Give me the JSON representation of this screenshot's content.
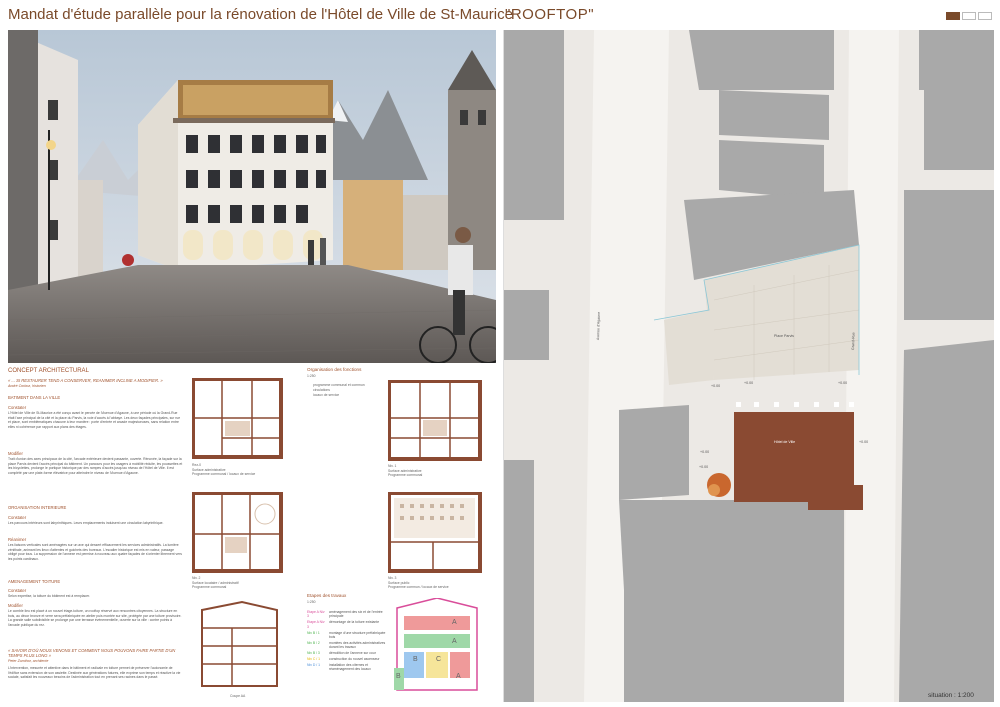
{
  "header": {
    "title": "Mandat d'étude parallèle pour la rénovation de l'Hôtel de Ville de St-Maurice",
    "project_name": "\"ROOFTOP\""
  },
  "concept": {
    "heading": "CONCEPT ARCHITECTURAL",
    "quote1": "« ... SI RESTAURER TEND A CONSERVER, REANIMER INCLINE A MODIFIER. »",
    "quote1_author": "André Corboz, historien",
    "s1_title": "BATIMENT DANS LA VILLE",
    "s1_constat": "Constater",
    "s1_p1": "L'Hôtel de Ville de St-Maurice a été conçu avant le percée de l'Avenue d'Agaune, à une période où la Grand-Rue était l'axe principal de la cité et la place du Parvis, la voie d'accès à l'abbaye. Les deux façades principales, sur rue et place, sont emblématiques chacune à leur manière : porte d'entrée et arcade majestueuses, sans relation entre elles ni cohérence par rapport aux plans des étages.",
    "s1_modif": "Modifier",
    "s1_p2": "Trait d'union des axes principaux de la cité, l'arcade extérieure devient passante, ouverte. Rénovée, la façade sur la place Parvis devient l'accès principal du bâtiment. Un parcours pour les usagers à mobilité réduite, les poussettes et les bicyclettes, prolonge le portique historique par des rampes d'accès jusqu'au niveau de l'Hôtel de Ville. Il est complété par une plate-forme élévatrice pour atteindre le niveau de l'Avenue d'Agaune.",
    "s2_title": "ORGANISATION INTERIEURE",
    "s2_constat": "Constater",
    "s2_p1": "Les parcours intérieurs sont labyrinthiques. Leurs emplacements induisent une circulation labyrinthique.",
    "s2_reanim": "Réanimer",
    "s2_p2": "Les liaisons verticales sont aménagées sur un axe qui dessert efficacement les services administratifs. La lumière zénithale, animant les lieux d'attentes et guichets des bureaux. L'escalier historique est mis en valeur, passage obligé pour tous. La suppression de l'annexe est permise à nouveau aux quatre façades de s'orienter librement vers les points cardinaux.",
    "s3_title": "AMENAGEMENT TOITURE",
    "s3_constat": "Constater",
    "s3_p1": "Selon expertise, la toiture du bâtiment est à remplacer.",
    "s3_modif": "Modifier",
    "s3_p2": "Le comble lieu est placé à un nouvel étage-toiture, un rooftop réservé aux rencontres citoyennes. La structure en bois, au décor bronze et verre sera préfabriquée en atelier puis montée sur site, protégée par une toiture provisoire. La grande salle subdivisible se prolonge par une terrasse évènementielle, ouverte sur la ville : contre points à l'arcade publique du rez.",
    "quote2": "« SAVOIR D'OÙ NOUS VENONS ET COMMENT NOUS POUVONS FAIRE PARTIE D'UN TEMPS PLUS LONG »",
    "quote2_author": "Peter Zumthor, architecte",
    "s4_p": "L'intervention, mesurée et attentive dans le bâtiment et radicale en toiture permet de préserver l'autonomie de l'édifice sans extension de son assiette. Destinée aux générations futures, elle exprime son temps et réactive la vie sociale, satisfait les nouveaux besoins de l'administration tout en prenant ses racines dans le passé."
  },
  "functions": {
    "title": "Organisation des fonctions",
    "scale": "1:250",
    "items": [
      "programme communal et commun",
      "circulations",
      "locaux de service"
    ]
  },
  "plans": {
    "p1_label": "Rez-0",
    "p1_cap": "Surface administrative\nProgramme communal / locaux de service",
    "p2_label": "Niv. 1",
    "p2_cap": "Surface administrative\nProgramme communal",
    "p3_label": "Niv. 2",
    "p3_cap": "Surface locataire / administratif\nProgramme communal",
    "p4_label": "Niv. 3",
    "p4_cap": "Surface public\nProgramme commun / locaux de service",
    "section_label": "Coupe AA"
  },
  "stages": {
    "title": "Etapes des travaux",
    "scale": "1:250",
    "items": [
      {
        "tag": "Etape A",
        "level": "Niv 3",
        "text": "aménagement des six et de l'entrée principale"
      },
      {
        "tag": "Etape A",
        "level": "Niv 3",
        "text": "démontage de la toiture existante"
      },
      {
        "tag": "Niv B / 1",
        "level": "",
        "text": "montage d'une structure préfabriquée bois"
      },
      {
        "tag": "Niv B / 2",
        "level": "",
        "text": "montées des activités administratives durant les travaux"
      },
      {
        "tag": "Niv B / 3",
        "level": "",
        "text": "démolition de l'annexe sur cour"
      },
      {
        "tag": "Niv C / 1",
        "level": "",
        "text": "construction du nouvel ascenseur"
      },
      {
        "tag": "Niv D / 1",
        "level": "",
        "text": "installation des citernes et réaménagement des locaux"
      }
    ],
    "section_letters": [
      "A",
      "A",
      "B",
      "C",
      "A",
      "B"
    ]
  },
  "map": {
    "labels": {
      "avenue": "Avenue d'Agaune",
      "grandrue": "Grand-Rue",
      "place": "Place Parvis",
      "hotel": "Hôtel de Ville"
    },
    "levels": [
      "+0.00",
      "+0.00",
      "+0.00",
      "+0.00",
      "+0.00",
      "+0.00"
    ],
    "scale_text": "situation : 1:200"
  },
  "colors": {
    "accent": "#7a4a2a",
    "brick": "#8a4a32",
    "building_gray": "#a8a8a8"
  }
}
